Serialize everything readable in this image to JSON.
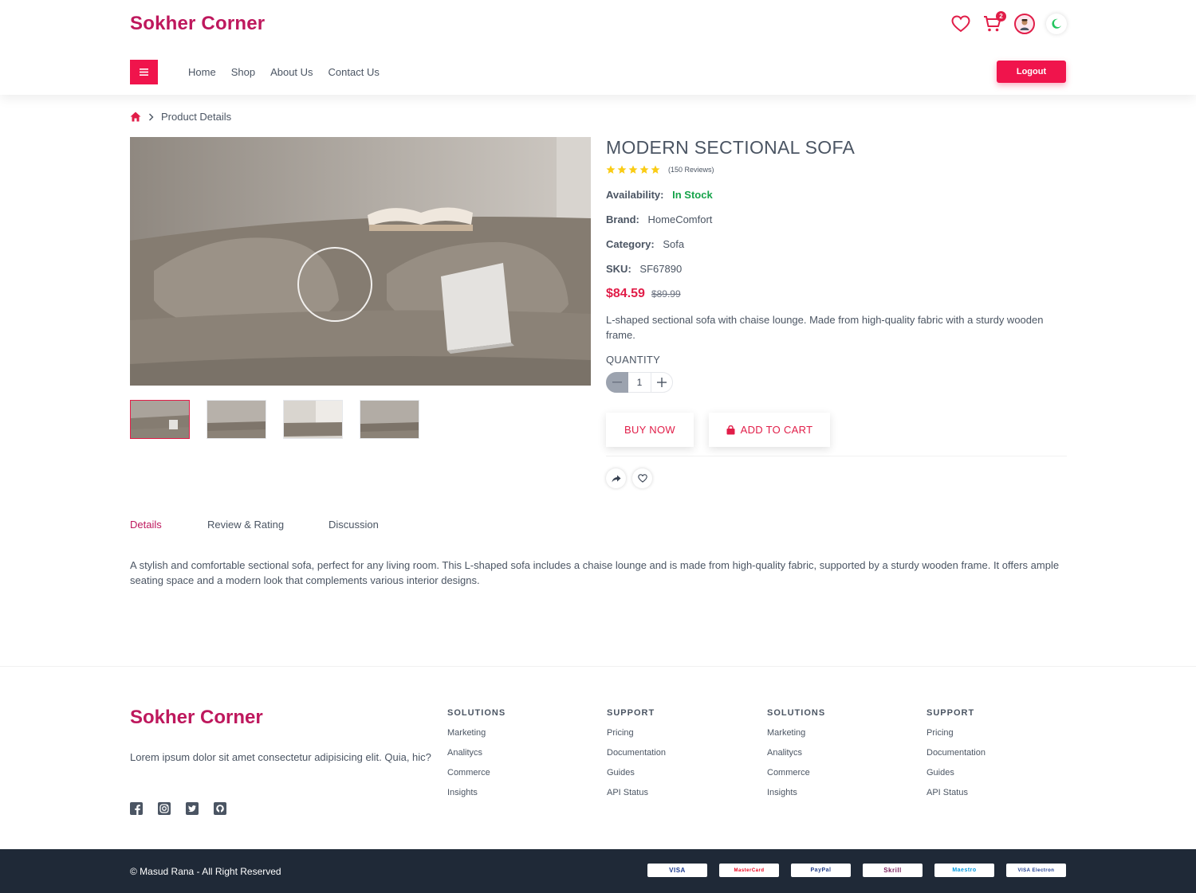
{
  "header": {
    "brand": "Sokher Corner",
    "cart_count": "2",
    "nav": [
      "Home",
      "Shop",
      "About Us",
      "Contact Us"
    ],
    "logout_label": "Logout"
  },
  "breadcrumb": {
    "current": "Product Details"
  },
  "product": {
    "title": "MODERN SECTIONAL SOFA",
    "stars": 5,
    "reviews": "(150 Reviews)",
    "availability_label": "Availability:",
    "availability": "In Stock",
    "brand_label": "Brand:",
    "brand": "HomeComfort",
    "category_label": "Category:",
    "category": "Sofa",
    "sku_label": "SKU:",
    "sku": "SF67890",
    "price": "$84.59",
    "old_price": "$89.99",
    "description": "L-shaped sectional sofa with chaise lounge. Made from high-quality fabric with a sturdy wooden frame.",
    "quantity_label": "QUANTITY",
    "quantity": "1",
    "buy_now": "BUY NOW",
    "add_to_cart": "ADD TO CART"
  },
  "tabs": [
    "Details",
    "Review & Rating",
    "Discussion"
  ],
  "details_text": "A stylish and comfortable sectional sofa, perfect for any living room. This L-shaped sofa includes a chaise lounge and is made from high-quality fabric, supported by a sturdy wooden frame. It offers ample seating space and a modern look that complements various interior designs.",
  "footer": {
    "brand": "Sokher Corner",
    "description": "Lorem ipsum dolor sit amet consectetur adipisicing elit. Quia, hic?",
    "columns": [
      {
        "title": "SOLUTIONS",
        "links": [
          "Marketing",
          "Analitycs",
          "Commerce",
          "Insights"
        ]
      },
      {
        "title": "SUPPORT",
        "links": [
          "Pricing",
          "Documentation",
          "Guides",
          "API Status"
        ]
      },
      {
        "title": "SOLUTIONS",
        "links": [
          "Marketing",
          "Analitycs",
          "Commerce",
          "Insights"
        ]
      },
      {
        "title": "SUPPORT",
        "links": [
          "Pricing",
          "Documentation",
          "Guides",
          "API Status"
        ]
      }
    ],
    "copyright": "© Masud Rana - All Right Reserved",
    "payment_cards": [
      "VISA",
      "MasterCard",
      "PayPal",
      "Skrill",
      "Maestro",
      "VISA Electron"
    ]
  },
  "colors": {
    "accent": "#f0144c",
    "brand": "#be185d",
    "instock": "#16a34a",
    "footer_bg": "#1f2937"
  },
  "icons": [
    "heart-icon",
    "cart-icon",
    "avatar",
    "moon-icon",
    "menu-icon",
    "home-icon",
    "chevron-right-icon",
    "star-icon",
    "bag-icon",
    "share-icon",
    "facebook-icon",
    "instagram-icon",
    "twitter-icon",
    "github-icon"
  ]
}
